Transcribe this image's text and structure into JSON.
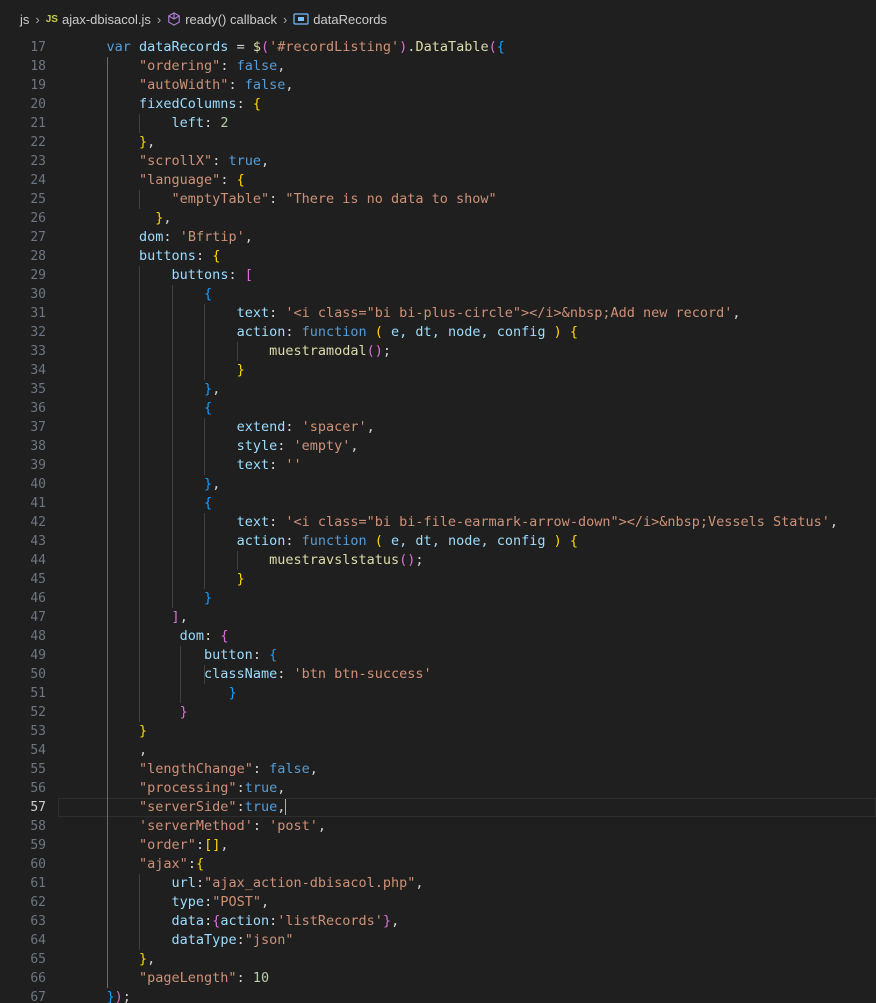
{
  "breadcrumb": {
    "folder": "js",
    "file_badge": "JS",
    "file": "ajax-dbisacol.js",
    "callback": "ready() callback",
    "symbol": "dataRecords"
  },
  "editor": {
    "first_line": 17,
    "active_line": 57,
    "line_numbers": [
      "17",
      "18",
      "19",
      "20",
      "21",
      "22",
      "23",
      "24",
      "25",
      "26",
      "27",
      "28",
      "29",
      "30",
      "31",
      "32",
      "33",
      "34",
      "35",
      "36",
      "37",
      "38",
      "39",
      "40",
      "41",
      "42",
      "43",
      "44",
      "45",
      "46",
      "47",
      "48",
      "49",
      "50",
      "51",
      "52",
      "53",
      "54",
      "55",
      "56",
      "57",
      "58",
      "59",
      "60",
      "61",
      "62",
      "63",
      "64",
      "65",
      "66",
      "67"
    ],
    "lines": [
      [
        [
          "    ",
          "p"
        ],
        [
          "var ",
          "k"
        ],
        [
          "dataRecords",
          "v"
        ],
        [
          " = ",
          "p"
        ],
        [
          "$",
          "f"
        ],
        [
          "(",
          "b2"
        ],
        [
          "'#recordListing'",
          "s"
        ],
        [
          ")",
          "b2"
        ],
        [
          ".",
          "p"
        ],
        [
          "DataTable",
          "f"
        ],
        [
          "(",
          "b2"
        ],
        [
          "{",
          "b3"
        ]
      ],
      [
        [
          "        ",
          "p"
        ],
        [
          "\"ordering\"",
          "s"
        ],
        [
          ": ",
          "p"
        ],
        [
          "false",
          "k"
        ],
        [
          ",",
          "p"
        ]
      ],
      [
        [
          "        ",
          "p"
        ],
        [
          "\"autoWidth\"",
          "s"
        ],
        [
          ": ",
          "p"
        ],
        [
          "false",
          "k"
        ],
        [
          ",",
          "p"
        ]
      ],
      [
        [
          "        ",
          "p"
        ],
        [
          "fixedColumns",
          "v"
        ],
        [
          ": ",
          "p"
        ],
        [
          "{",
          "b1"
        ]
      ],
      [
        [
          "            ",
          "p"
        ],
        [
          "left",
          "v"
        ],
        [
          ": ",
          "p"
        ],
        [
          "2",
          "n"
        ]
      ],
      [
        [
          "        ",
          "p"
        ],
        [
          "}",
          "b1"
        ],
        [
          ",",
          "p"
        ]
      ],
      [
        [
          "        ",
          "p"
        ],
        [
          "\"scrollX\"",
          "s"
        ],
        [
          ": ",
          "p"
        ],
        [
          "true",
          "k"
        ],
        [
          ",",
          "p"
        ]
      ],
      [
        [
          "        ",
          "p"
        ],
        [
          "\"language\"",
          "s"
        ],
        [
          ": ",
          "p"
        ],
        [
          "{",
          "b1"
        ]
      ],
      [
        [
          "            ",
          "p"
        ],
        [
          "\"emptyTable\"",
          "s"
        ],
        [
          ": ",
          "p"
        ],
        [
          "\"There is no data to show\"",
          "s"
        ]
      ],
      [
        [
          "          ",
          "p"
        ],
        [
          "}",
          "b1"
        ],
        [
          ",",
          "p"
        ]
      ],
      [
        [
          "        ",
          "p"
        ],
        [
          "dom",
          "v"
        ],
        [
          ": ",
          "p"
        ],
        [
          "'Bfrtip'",
          "s"
        ],
        [
          ",",
          "p"
        ]
      ],
      [
        [
          "        ",
          "p"
        ],
        [
          "buttons",
          "v"
        ],
        [
          ": ",
          "p"
        ],
        [
          "{",
          "b1"
        ]
      ],
      [
        [
          "            ",
          "p"
        ],
        [
          "buttons",
          "v"
        ],
        [
          ": ",
          "p"
        ],
        [
          "[",
          "b2"
        ]
      ],
      [
        [
          "                ",
          "p"
        ],
        [
          "{",
          "b3"
        ]
      ],
      [
        [
          "                    ",
          "p"
        ],
        [
          "text",
          "v"
        ],
        [
          ": ",
          "p"
        ],
        [
          "'<i class=\"bi bi-plus-circle\"></i>&nbsp;Add new record'",
          "s"
        ],
        [
          ",",
          "p"
        ]
      ],
      [
        [
          "                    ",
          "p"
        ],
        [
          "action",
          "v"
        ],
        [
          ": ",
          "p"
        ],
        [
          "function",
          "k"
        ],
        [
          " ",
          "p"
        ],
        [
          "(",
          "b1"
        ],
        [
          " e, dt, node, config ",
          "v"
        ],
        [
          ")",
          "b1"
        ],
        [
          " ",
          "p"
        ],
        [
          "{",
          "b1"
        ]
      ],
      [
        [
          "                        ",
          "p"
        ],
        [
          "muestramodal",
          "f"
        ],
        [
          "(",
          "b2"
        ],
        [
          ")",
          "b2"
        ],
        [
          ";",
          "p"
        ]
      ],
      [
        [
          "                    ",
          "p"
        ],
        [
          "}",
          "b1"
        ]
      ],
      [
        [
          "                ",
          "p"
        ],
        [
          "}",
          "b3"
        ],
        [
          ",",
          "p"
        ]
      ],
      [
        [
          "                ",
          "p"
        ],
        [
          "{",
          "b3"
        ]
      ],
      [
        [
          "                    ",
          "p"
        ],
        [
          "extend",
          "v"
        ],
        [
          ": ",
          "p"
        ],
        [
          "'spacer'",
          "s"
        ],
        [
          ",",
          "p"
        ]
      ],
      [
        [
          "                    ",
          "p"
        ],
        [
          "style",
          "v"
        ],
        [
          ": ",
          "p"
        ],
        [
          "'empty'",
          "s"
        ],
        [
          ",",
          "p"
        ]
      ],
      [
        [
          "                    ",
          "p"
        ],
        [
          "text",
          "v"
        ],
        [
          ": ",
          "p"
        ],
        [
          "''",
          "s"
        ]
      ],
      [
        [
          "                ",
          "p"
        ],
        [
          "}",
          "b3"
        ],
        [
          ",",
          "p"
        ]
      ],
      [
        [
          "                ",
          "p"
        ],
        [
          "{",
          "b3"
        ]
      ],
      [
        [
          "                    ",
          "p"
        ],
        [
          "text",
          "v"
        ],
        [
          ": ",
          "p"
        ],
        [
          "'<i class=\"bi bi-file-earmark-arrow-down\"></i>&nbsp;Vessels Status'",
          "s"
        ],
        [
          ",",
          "p"
        ]
      ],
      [
        [
          "                    ",
          "p"
        ],
        [
          "action",
          "v"
        ],
        [
          ": ",
          "p"
        ],
        [
          "function",
          "k"
        ],
        [
          " ",
          "p"
        ],
        [
          "(",
          "b1"
        ],
        [
          " e, dt, node, config ",
          "v"
        ],
        [
          ")",
          "b1"
        ],
        [
          " ",
          "p"
        ],
        [
          "{",
          "b1"
        ]
      ],
      [
        [
          "                        ",
          "p"
        ],
        [
          "muestravslstatus",
          "f"
        ],
        [
          "(",
          "b2"
        ],
        [
          ")",
          "b2"
        ],
        [
          ";",
          "p"
        ]
      ],
      [
        [
          "                    ",
          "p"
        ],
        [
          "}",
          "b1"
        ]
      ],
      [
        [
          "                ",
          "p"
        ],
        [
          "}",
          "b3"
        ]
      ],
      [
        [
          "            ",
          "p"
        ],
        [
          "]",
          "b2"
        ],
        [
          ",",
          "p"
        ]
      ],
      [
        [
          "             ",
          "p"
        ],
        [
          "dom",
          "v"
        ],
        [
          ": ",
          "p"
        ],
        [
          "{",
          "b2"
        ]
      ],
      [
        [
          "                ",
          "p"
        ],
        [
          "button",
          "v"
        ],
        [
          ": ",
          "p"
        ],
        [
          "{",
          "b3"
        ]
      ],
      [
        [
          "                ",
          "p"
        ],
        [
          "className",
          "v"
        ],
        [
          ": ",
          "p"
        ],
        [
          "'btn btn-success'",
          "s"
        ]
      ],
      [
        [
          "                   ",
          "p"
        ],
        [
          "}",
          "b3"
        ]
      ],
      [
        [
          "             ",
          "p"
        ],
        [
          "}",
          "b2"
        ]
      ],
      [
        [
          "        ",
          "p"
        ],
        [
          "}",
          "b1"
        ]
      ],
      [
        [
          "        ",
          "p"
        ],
        [
          ",",
          "p"
        ]
      ],
      [
        [
          "        ",
          "p"
        ],
        [
          "\"lengthChange\"",
          "s"
        ],
        [
          ": ",
          "p"
        ],
        [
          "false",
          "k"
        ],
        [
          ",",
          "p"
        ]
      ],
      [
        [
          "        ",
          "p"
        ],
        [
          "\"processing\"",
          "s"
        ],
        [
          ":",
          "p"
        ],
        [
          "true",
          "k"
        ],
        [
          ",",
          "p"
        ]
      ],
      [
        [
          "        ",
          "p"
        ],
        [
          "\"serverSide\"",
          "s"
        ],
        [
          ":",
          "p"
        ],
        [
          "true",
          "k"
        ],
        [
          ",",
          "p"
        ]
      ],
      [
        [
          "        ",
          "p"
        ],
        [
          "'serverMethod'",
          "s"
        ],
        [
          ": ",
          "p"
        ],
        [
          "'post'",
          "s"
        ],
        [
          ",",
          "p"
        ]
      ],
      [
        [
          "        ",
          "p"
        ],
        [
          "\"order\"",
          "s"
        ],
        [
          ":",
          "p"
        ],
        [
          "[",
          "b1"
        ],
        [
          "]",
          "b1"
        ],
        [
          ",",
          "p"
        ]
      ],
      [
        [
          "        ",
          "p"
        ],
        [
          "\"ajax\"",
          "s"
        ],
        [
          ":",
          "p"
        ],
        [
          "{",
          "b1"
        ]
      ],
      [
        [
          "            ",
          "p"
        ],
        [
          "url",
          "v"
        ],
        [
          ":",
          "p"
        ],
        [
          "\"ajax_action-dbisacol.php\"",
          "s"
        ],
        [
          ",",
          "p"
        ]
      ],
      [
        [
          "            ",
          "p"
        ],
        [
          "type",
          "v"
        ],
        [
          ":",
          "p"
        ],
        [
          "\"POST\"",
          "s"
        ],
        [
          ",",
          "p"
        ]
      ],
      [
        [
          "            ",
          "p"
        ],
        [
          "data",
          "v"
        ],
        [
          ":",
          "p"
        ],
        [
          "{",
          "b2"
        ],
        [
          "action",
          "v"
        ],
        [
          ":",
          "p"
        ],
        [
          "'listRecords'",
          "s"
        ],
        [
          "}",
          "b2"
        ],
        [
          ",",
          "p"
        ]
      ],
      [
        [
          "            ",
          "p"
        ],
        [
          "dataType",
          "v"
        ],
        [
          ":",
          "p"
        ],
        [
          "\"json\"",
          "s"
        ]
      ],
      [
        [
          "        ",
          "p"
        ],
        [
          "}",
          "b1"
        ],
        [
          ",",
          "p"
        ]
      ],
      [
        [
          "        ",
          "p"
        ],
        [
          "\"pageLength\"",
          "s"
        ],
        [
          ": ",
          "p"
        ],
        [
          "10",
          "n"
        ]
      ],
      [
        [
          "    ",
          "p"
        ],
        [
          "}",
          "b3"
        ],
        [
          ")",
          "b2"
        ],
        [
          ";",
          "p"
        ]
      ]
    ]
  }
}
